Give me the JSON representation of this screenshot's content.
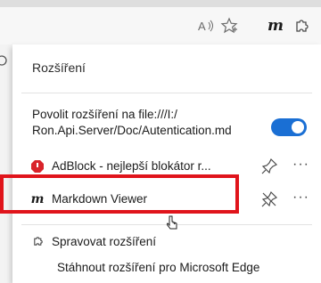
{
  "toolbar": {
    "read_aloud_icon": "read-aloud-icon",
    "favorites_icon": "star-icon",
    "markdown_icon_label": "m",
    "extensions_icon": "puzzle-icon"
  },
  "panel": {
    "title": "Rozšíření",
    "file_access": {
      "label": "Povolit rozšíření na file:///I:/ Ron.Api.Server/Doc/Autentication.md",
      "enabled": true
    },
    "extensions": [
      {
        "name": "AdBlock - nejlepší blokátor r...",
        "icon": "adblock-icon",
        "pinned": false
      },
      {
        "name": "Markdown Viewer",
        "icon_label": "m",
        "pinned": true
      }
    ],
    "manage_label": "Spravovat rozšíření",
    "store_link": "Stáhnout rozšíření pro Microsoft Edge"
  },
  "colors": {
    "toggle_on": "#1a6fd4",
    "highlight_border": "#e0141b",
    "adblock_red": "#d9242b"
  }
}
